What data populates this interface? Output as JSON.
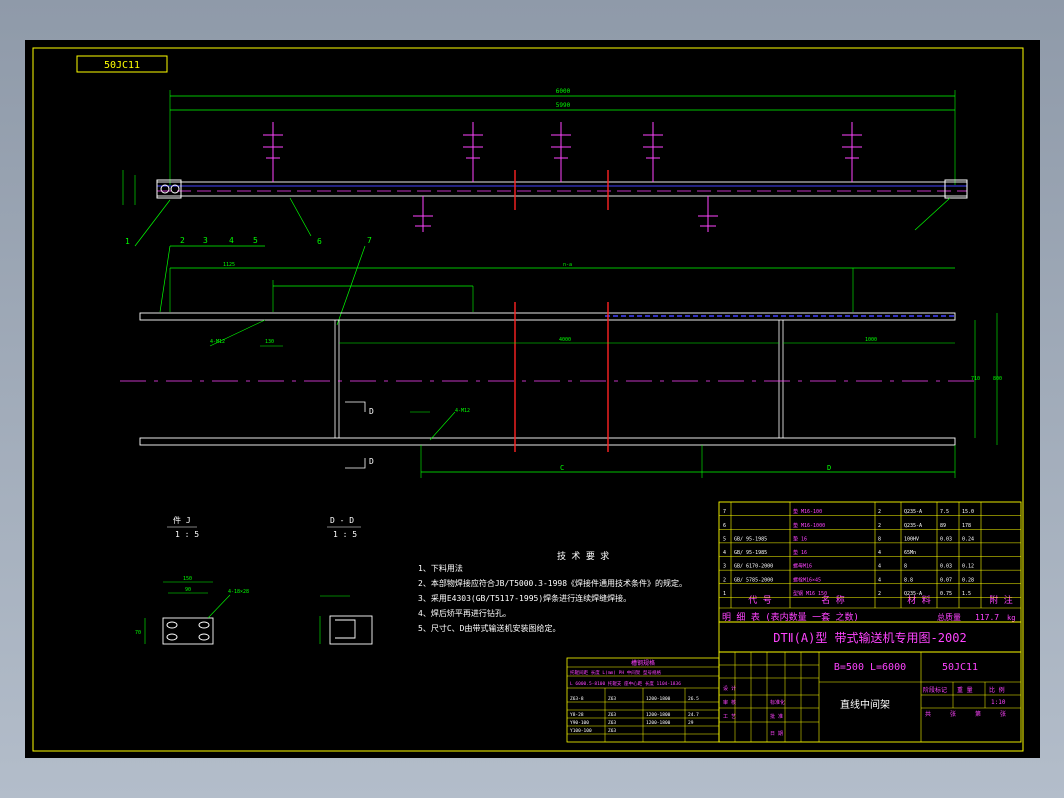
{
  "drawing": {
    "code_box": "50JC11",
    "dims": {
      "overall_top": "6000",
      "inner_top": "5990",
      "span_mid": "1125",
      "span_long": "n-a",
      "bolt_label": "4-M12",
      "half_left": "C",
      "half_right": "D",
      "dim_4000": "4000",
      "dim_1000": "1000",
      "dim_130": "130",
      "dim_width_inner": "710",
      "dim_width_outer": "800"
    },
    "callouts": [
      "1",
      "2",
      "3",
      "4",
      "5",
      "6",
      "7"
    ],
    "section_labels": {
      "view_j": "件 J",
      "view_j_scale": "1 : 5",
      "view_d": "D - D",
      "view_d_scale": "1 : 5",
      "cut_d_top": "D",
      "cut_d_bottom": "D"
    },
    "detail_dims": {
      "w150": "150",
      "w90": "90",
      "h70": "70",
      "holes": "4-18×28"
    },
    "tech_req": {
      "title": "技 术 要 求",
      "items": [
        "1、下料用法",
        "2、本部物焊接应符合JB/T5000.3-1998《焊接件通用技术条件》的规定。",
        "3、采用E4303(GB/T5117-1995)焊条进行连续焊缝焊接。",
        "4、焊后矫平再进行钻孔。",
        "5、尺寸C、D由带式输送机安装图给定。"
      ]
    }
  },
  "title_block": {
    "parts_rows": [
      {
        "no": "7",
        "code": "",
        "name": "垫 M16-100",
        "qty": "2",
        "mat": "Q235-A",
        "w1": "7.5",
        "w2": "15.0"
      },
      {
        "no": "6",
        "code": "",
        "name": "垫 M16-1000",
        "qty": "2",
        "mat": "Q235-A",
        "w1": "89",
        "w2": "178"
      },
      {
        "no": "5",
        "code": "GB/ 95-1985",
        "name": "垫 16",
        "qty": "8",
        "mat": "100HV",
        "w1": "0.03",
        "w2": "0.24"
      },
      {
        "no": "4",
        "code": "GB/ 95-1985",
        "name": "垫 16",
        "qty": "4",
        "mat": "65Mn",
        "w1": "",
        "w2": ""
      },
      {
        "no": "3",
        "code": "GB/ 6170-2000",
        "name": "螺母M16",
        "qty": "4",
        "mat": "8",
        "w1": "0.03",
        "w2": "0.12"
      },
      {
        "no": "2",
        "code": "GB/ 5785-2000",
        "name": "螺栓M16×45",
        "qty": "4",
        "mat": "8.8",
        "w1": "0.07",
        "w2": "0.28"
      },
      {
        "no": "1",
        "code": "",
        "name": "型钢 M16 150",
        "qty": "2",
        "mat": "Q235-A",
        "w1": "0.75",
        "w2": "1.5"
      }
    ],
    "header": {
      "no": "",
      "code": "代 号",
      "name": "名 称",
      "qty": "",
      "mat": "材 料",
      "weight": "",
      "note": "附 注"
    },
    "mingxi": "明 细 表 (表内数量 一套 之数)",
    "total_weight_label": "总质量",
    "total_weight_value": "117.7",
    "total_weight_unit": "kg",
    "series_title": "DTⅡ(A)型 带式输送机专用图-2002",
    "spec": "B=500 L=6000",
    "drawing_no": "50JC11",
    "part_name": "直线中间架",
    "small_table": {
      "title": "槽钢规格",
      "note1": "托辊间距 长度 L(mm)  PH 中间架 型号规格",
      "note2": "L 6000.5-8100 托辊支 座中心距 长度 1104-1836",
      "rows": [
        [
          "Z63-8",
          "Z63",
          "1200-1800",
          "26.5"
        ],
        [
          "Y8-28",
          "Z63",
          "1200-1800",
          "24.7"
        ],
        [
          "Y90-100",
          "Z63",
          "1200-1800",
          "29"
        ],
        [
          "Y100-100",
          "Z63",
          "",
          ""
        ]
      ]
    },
    "sign_labels": {
      "design": "设 计",
      "check": "审 核",
      "std": "标准化",
      "approve": "批 准",
      "process": "工 艺",
      "date": "日 期",
      "stage": "阶段标记",
      "weight": "重 量",
      "scale": "比 例",
      "scale_value": "1:10",
      "sheet": "共",
      "sheet2": "张",
      "sheet3": "第",
      "sheet4": "张"
    }
  }
}
